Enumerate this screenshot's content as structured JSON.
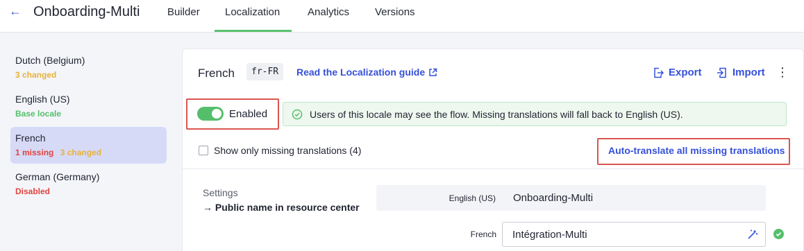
{
  "header": {
    "back_icon": "arrow-left-icon",
    "title": "Onboarding-Multi",
    "tabs": [
      {
        "label": "Builder",
        "active": false
      },
      {
        "label": "Localization",
        "active": true
      },
      {
        "label": "Analytics",
        "active": false
      },
      {
        "label": "Versions",
        "active": false
      }
    ]
  },
  "sidebar": {
    "locales": [
      {
        "name": "Dutch (Belgium)",
        "status": [
          "3 changed"
        ],
        "selected": false
      },
      {
        "name": "English (US)",
        "status": [
          "Base locale"
        ],
        "selected": false
      },
      {
        "name": "French",
        "status": [
          "1 missing",
          "3 changed"
        ],
        "selected": true
      },
      {
        "name": "German (Germany)",
        "status": [
          "Disabled"
        ],
        "selected": false
      }
    ]
  },
  "main": {
    "locale_title": "French",
    "locale_code": "fr-FR",
    "guide_link": "Read the Localization guide",
    "export_label": "Export",
    "import_label": "Import",
    "enabled_label": "Enabled",
    "enabled": true,
    "info_text": "Users of this locale may see the flow. Missing translations will fall back to English (US).",
    "missing_filter_label": "Show only missing translations (4)",
    "autotranslate_label": "Auto-translate all missing translations",
    "settings": {
      "section_label": "Settings",
      "field_label": "→ Public name in resource center",
      "source_lang": "English (US)",
      "source_value": "Onboarding-Multi",
      "target_lang": "French",
      "target_value": "Intégration-Multi"
    }
  },
  "colors": {
    "accent": "#3550d8",
    "success": "#55be6b",
    "changed": "#e8b23a",
    "error": "#e0443e",
    "selected_bg": "#d6daf7",
    "highlight_box": "#d8564f"
  }
}
